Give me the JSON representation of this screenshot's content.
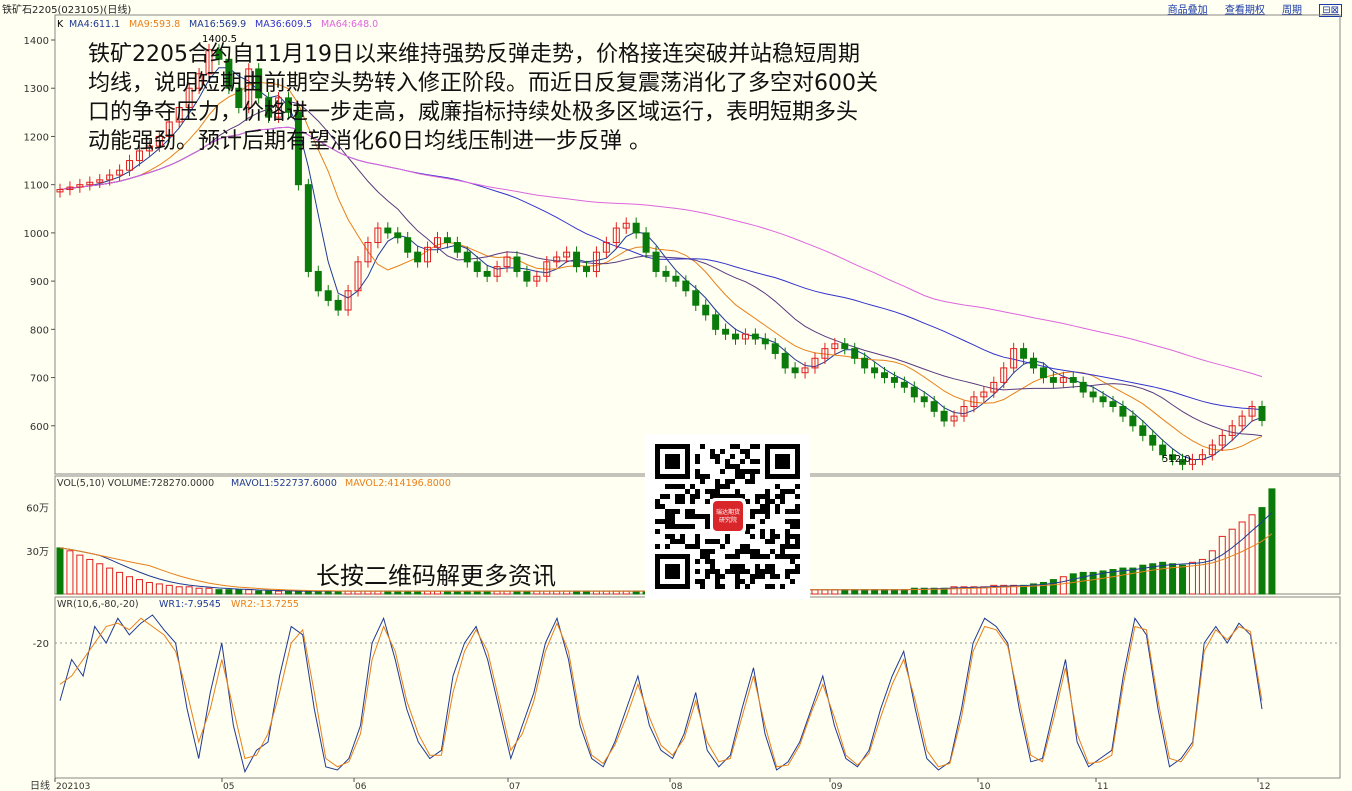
{
  "header": {
    "title": "铁矿石2205(023105)(日线)",
    "links": [
      "商品叠加",
      "查看期权",
      "周期"
    ],
    "window_button": "⊟⊠"
  },
  "price_panel": {
    "legend": [
      {
        "label": "K",
        "color": "#000000"
      },
      {
        "label": "MA4:611.1",
        "color": "#1f3a93"
      },
      {
        "label": "MA9:593.8",
        "color": "#e8801a"
      },
      {
        "label": "MA16:569.9",
        "color": "#1f3a93"
      },
      {
        "label": "MA36:609.5",
        "color": "#3333cc"
      },
      {
        "label": "MA64:648.0",
        "color": "#dd66dd"
      }
    ],
    "y_ticks": [
      "1400",
      "1300",
      "1200",
      "1100",
      "1000",
      "900",
      "800",
      "700",
      "600"
    ],
    "annotations": {
      "high": "1400.5",
      "low": "512.0"
    }
  },
  "volume_panel": {
    "legend": [
      {
        "label": "VOL(5,10) VOLUME:728270.0000",
        "color": "#333333"
      },
      {
        "label": "MAVOL1:522737.6000",
        "color": "#1f3a93"
      },
      {
        "label": "MAVOL2:414196.8000",
        "color": "#e8801a"
      }
    ],
    "y_ticks": [
      "60万",
      "30万"
    ]
  },
  "wr_panel": {
    "legend": [
      {
        "label": "WR(10,6,-80,-20)",
        "color": "#333333"
      },
      {
        "label": "WR1:-7.9545",
        "color": "#1f3a93"
      },
      {
        "label": "WR2:-13.7255",
        "color": "#e8801a"
      }
    ],
    "y_ticks": [
      "-20"
    ]
  },
  "x_axis": {
    "label": "日线",
    "ticks": [
      "202103",
      "05",
      "06",
      "07",
      "08",
      "09",
      "10",
      "11",
      "12"
    ]
  },
  "overlay_text": "铁矿2205合约自11月19日以来维持强势反弹走势，价格接连突破并站稳短周期均线，说明短期由前期空头势转入修正阶段。而近日反复震荡消化了多空对600关口的争夺压力，价格进一步走高，威廉指标持续处极多区域运行，表明短期多头动能强劲。预计后期有望消化60日均线压制进一步反弹 。",
  "qr_center_text": [
    "瑞达期货",
    "研究院"
  ],
  "qr_caption": "长按二维码解更多资讯",
  "colors": {
    "up": "#e02020",
    "down": "#0a7a0a",
    "bg": "#fffff2"
  },
  "chart_data": [
    {
      "type": "candlestick",
      "ylim": [
        500,
        1420
      ],
      "ma_series": [
        "MA4",
        "MA9",
        "MA16",
        "MA36",
        "MA64"
      ],
      "close": [
        1090,
        1095,
        1100,
        1105,
        1110,
        1120,
        1130,
        1150,
        1170,
        1180,
        1200,
        1230,
        1260,
        1300,
        1330,
        1380,
        1360,
        1300,
        1260,
        1340,
        1280,
        1240,
        1280,
        1250,
        1100,
        920,
        880,
        860,
        840,
        880,
        940,
        980,
        1010,
        1000,
        990,
        960,
        940,
        970,
        990,
        980,
        960,
        940,
        920,
        910,
        930,
        950,
        920,
        900,
        910,
        940,
        950,
        960,
        930,
        920,
        960,
        980,
        1010,
        1020,
        1000,
        960,
        920,
        910,
        900,
        880,
        850,
        830,
        800,
        790,
        780,
        790,
        780,
        770,
        750,
        720,
        710,
        720,
        740,
        760,
        770,
        760,
        740,
        720,
        710,
        700,
        690,
        680,
        660,
        650,
        630,
        610,
        620,
        640,
        660,
        670,
        690,
        720,
        760,
        740,
        720,
        700,
        690,
        700,
        690,
        670,
        660,
        650,
        640,
        620,
        600,
        580,
        560,
        540,
        530,
        520,
        530,
        540,
        560,
        580,
        600,
        620,
        640,
        611
      ]
    },
    {
      "type": "bar",
      "series": [
        {
          "name": "VOL",
          "values": [
            32,
            30,
            27,
            24,
            21,
            18,
            15,
            12,
            10,
            8,
            7,
            6,
            5,
            5,
            4,
            4,
            3,
            3,
            3,
            3,
            2,
            2,
            2,
            2,
            2,
            2,
            2,
            2,
            2,
            2,
            2,
            2,
            2,
            2,
            2,
            2,
            2,
            2,
            2,
            2,
            2,
            2,
            2,
            2,
            2,
            2,
            2,
            2,
            2,
            2,
            2,
            2,
            2,
            2,
            2,
            2,
            2,
            2,
            2,
            2,
            2,
            2,
            2,
            2,
            2,
            2,
            3,
            3,
            3,
            3,
            3,
            3,
            3,
            3,
            3,
            3,
            3,
            3,
            3,
            3,
            3,
            3,
            3,
            3,
            3,
            3,
            4,
            4,
            4,
            4,
            5,
            5,
            5,
            5,
            6,
            6,
            6,
            6,
            7,
            8,
            10,
            12,
            14,
            15,
            15,
            16,
            17,
            18,
            18,
            20,
            21,
            22,
            21,
            20,
            22,
            24,
            30,
            40,
            45,
            50,
            55,
            60,
            73
          ]
        }
      ],
      "ylim": [
        0,
        75
      ]
    },
    {
      "type": "line",
      "series": [
        {
          "name": "WR1",
          "values": [
            -55,
            -30,
            -40,
            -10,
            -20,
            -5,
            -15,
            -8,
            -3,
            -12,
            -20,
            -60,
            -90,
            -50,
            -20,
            -70,
            -98,
            -85,
            -80,
            -40,
            -10,
            -15,
            -60,
            -95,
            -97,
            -90,
            -70,
            -20,
            -5,
            -30,
            -60,
            -80,
            -90,
            -85,
            -40,
            -20,
            -10,
            -30,
            -60,
            -90,
            -70,
            -50,
            -20,
            -5,
            -30,
            -70,
            -90,
            -95,
            -80,
            -60,
            -40,
            -70,
            -85,
            -90,
            -75,
            -50,
            -85,
            -95,
            -88,
            -60,
            -35,
            -75,
            -97,
            -92,
            -80,
            -60,
            -40,
            -70,
            -90,
            -95,
            -85,
            -60,
            -40,
            -25,
            -60,
            -90,
            -97,
            -92,
            -60,
            -20,
            -5,
            -10,
            -20,
            -60,
            -92,
            -90,
            -60,
            -30,
            -80,
            -95,
            -90,
            -85,
            -40,
            -5,
            -15,
            -60,
            -95,
            -90,
            -80,
            -20,
            -10,
            -20,
            -8,
            -15,
            -60
          ]
        },
        {
          "name": "WR2",
          "values": [
            -45,
            -40,
            -30,
            -20,
            -10,
            -8,
            -12,
            -5,
            -10,
            -15,
            -25,
            -50,
            -80,
            -60,
            -30,
            -60,
            -90,
            -88,
            -75,
            -50,
            -20,
            -12,
            -50,
            -90,
            -95,
            -92,
            -75,
            -30,
            -10,
            -25,
            -55,
            -75,
            -88,
            -88,
            -50,
            -25,
            -12,
            -25,
            -55,
            -85,
            -75,
            -55,
            -25,
            -8,
            -25,
            -65,
            -88,
            -93,
            -82,
            -65,
            -45,
            -65,
            -82,
            -88,
            -78,
            -55,
            -80,
            -92,
            -90,
            -65,
            -40,
            -70,
            -95,
            -94,
            -82,
            -62,
            -45,
            -65,
            -88,
            -94,
            -87,
            -65,
            -45,
            -30,
            -55,
            -85,
            -95,
            -93,
            -65,
            -25,
            -10,
            -12,
            -22,
            -55,
            -88,
            -92,
            -65,
            -35,
            -75,
            -93,
            -92,
            -88,
            -45,
            -10,
            -12,
            -55,
            -90,
            -92,
            -82,
            -25,
            -12,
            -18,
            -10,
            -13,
            -55
          ]
        }
      ],
      "ylim": [
        -100,
        0
      ]
    }
  ]
}
